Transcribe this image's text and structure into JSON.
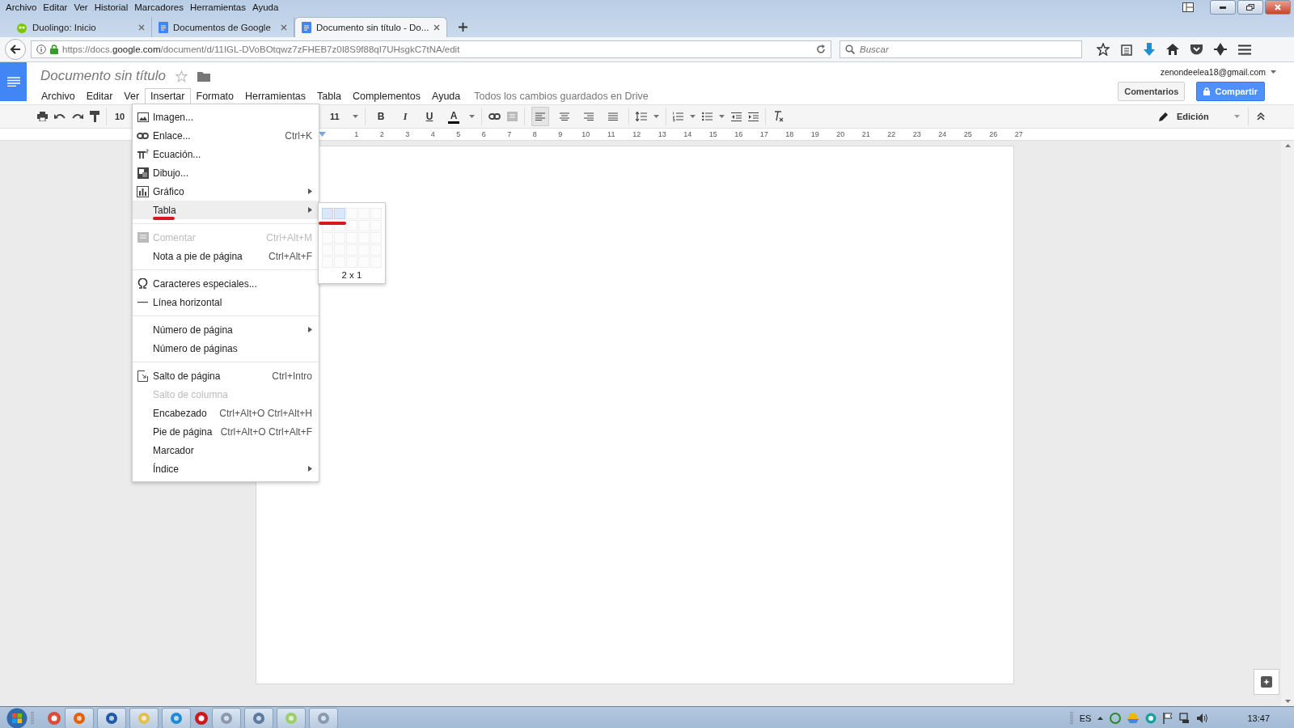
{
  "browser_menu": [
    "Archivo",
    "Editar",
    "Ver",
    "Historial",
    "Marcadores",
    "Herramientas",
    "Ayuda"
  ],
  "browser_tabs": [
    {
      "title": "Duolingo: Inicio",
      "selected": false
    },
    {
      "title": "Documentos de Google",
      "selected": false
    },
    {
      "title": "Documento sin título - Do...",
      "selected": true
    }
  ],
  "address_bar": {
    "url": "https://docs.**google.com**/document/d/11IGL-DVoBOtqwz7zFHEB7z0I8S9f88qI7UHsgkC7tNA/edit"
  },
  "search": {
    "placeholder": "Buscar"
  },
  "doc": {
    "title": "Documento sin título",
    "menu": [
      {
        "label": "Archivo",
        "selected": false
      },
      {
        "label": "Editar",
        "selected": false
      },
      {
        "label": "Ver",
        "selected": false
      },
      {
        "label": "Insertar",
        "selected": true
      },
      {
        "label": "Formato",
        "selected": false
      },
      {
        "label": "Herramientas",
        "selected": false
      },
      {
        "label": "Tabla",
        "selected": false
      },
      {
        "label": "Complementos",
        "selected": false
      },
      {
        "label": "Ayuda",
        "selected": false
      }
    ],
    "save_status": "Todos los cambios guardados en Drive",
    "account": "zenondeelea18@gmail.com",
    "comments_button": "Comentarios",
    "share_button": "Compartir"
  },
  "toolbar": {
    "zoom": "10",
    "font_size": "11",
    "bold": "B",
    "italic": "I",
    "underline": "U",
    "text_color": "A",
    "alignment": [
      {
        "selected": true
      },
      {
        "selected": false
      },
      {
        "selected": false
      },
      {
        "selected": false
      }
    ],
    "mode": "Edición"
  },
  "ruler": [
    "1",
    "2",
    "3",
    "4",
    "5",
    "6",
    "7",
    "8",
    "9",
    "10",
    "11",
    "12",
    "13",
    "14",
    "15",
    "16",
    "17",
    "18",
    "19",
    "20",
    "21",
    "22",
    "23",
    "24",
    "25",
    "26",
    "27"
  ],
  "insert_menu": {
    "groups": [
      [
        {
          "label": "Imagen...",
          "submenu": false,
          "disabled": false,
          "selected": false
        },
        {
          "label": "Enlace...",
          "shortcut": "Ctrl+K",
          "submenu": false,
          "disabled": false,
          "selected": false
        },
        {
          "label": "Ecuación...",
          "submenu": false,
          "disabled": false,
          "selected": false
        },
        {
          "label": "Dibujo...",
          "submenu": false,
          "disabled": false,
          "selected": false
        },
        {
          "label": "Gráfico",
          "submenu": true,
          "disabled": false,
          "selected": false
        },
        {
          "label": "Tabla",
          "submenu": true,
          "disabled": false,
          "selected": true
        }
      ],
      [
        {
          "label": "Comentar",
          "shortcut": "Ctrl+Alt+M",
          "submenu": false,
          "disabled": true,
          "selected": false
        },
        {
          "label": "Nota a pie de página",
          "shortcut": "Ctrl+Alt+F",
          "submenu": false,
          "disabled": false,
          "selected": false
        }
      ],
      [
        {
          "label": "Caracteres especiales...",
          "submenu": false,
          "disabled": false,
          "selected": false
        },
        {
          "label": "Línea horizontal",
          "submenu": false,
          "disabled": false,
          "selected": false
        }
      ],
      [
        {
          "label": "Número de página",
          "submenu": true,
          "disabled": false,
          "selected": false
        },
        {
          "label": "Número de páginas",
          "submenu": false,
          "disabled": false,
          "selected": false
        }
      ],
      [
        {
          "label": "Salto de página",
          "shortcut": "Ctrl+Intro",
          "submenu": false,
          "disabled": false,
          "selected": false
        },
        {
          "label": "Salto de columna",
          "submenu": false,
          "disabled": true,
          "selected": false
        },
        {
          "label": "Encabezado",
          "shortcut": "Ctrl+Alt+O Ctrl+Alt+H",
          "submenu": false,
          "disabled": false,
          "selected": false
        },
        {
          "label": "Pie de página",
          "shortcut": "Ctrl+Alt+O Ctrl+Alt+F",
          "submenu": false,
          "disabled": false,
          "selected": false
        },
        {
          "label": "Marcador",
          "submenu": false,
          "disabled": false,
          "selected": false
        },
        {
          "label": "Índice",
          "submenu": true,
          "disabled": false,
          "selected": false
        }
      ]
    ]
  },
  "table_picker": {
    "rows": [
      [
        {
          "selected": true
        },
        {
          "selected": true
        },
        {
          "selected": false
        },
        {
          "selected": false
        },
        {
          "selected": false
        }
      ],
      [
        {
          "selected": false
        },
        {
          "selected": false
        },
        {
          "selected": false
        },
        {
          "selected": false
        },
        {
          "selected": false
        }
      ],
      [
        {
          "selected": false
        },
        {
          "selected": false
        },
        {
          "selected": false
        },
        {
          "selected": false
        },
        {
          "selected": false
        }
      ],
      [
        {
          "selected": false
        },
        {
          "selected": false
        },
        {
          "selected": false
        },
        {
          "selected": false
        },
        {
          "selected": false
        }
      ],
      [
        {
          "selected": false
        },
        {
          "selected": false
        },
        {
          "selected": false
        },
        {
          "selected": false
        },
        {
          "selected": false
        }
      ]
    ],
    "size": "2 x 1"
  },
  "taskbar": {
    "language": "ES",
    "clock": "13:47"
  }
}
